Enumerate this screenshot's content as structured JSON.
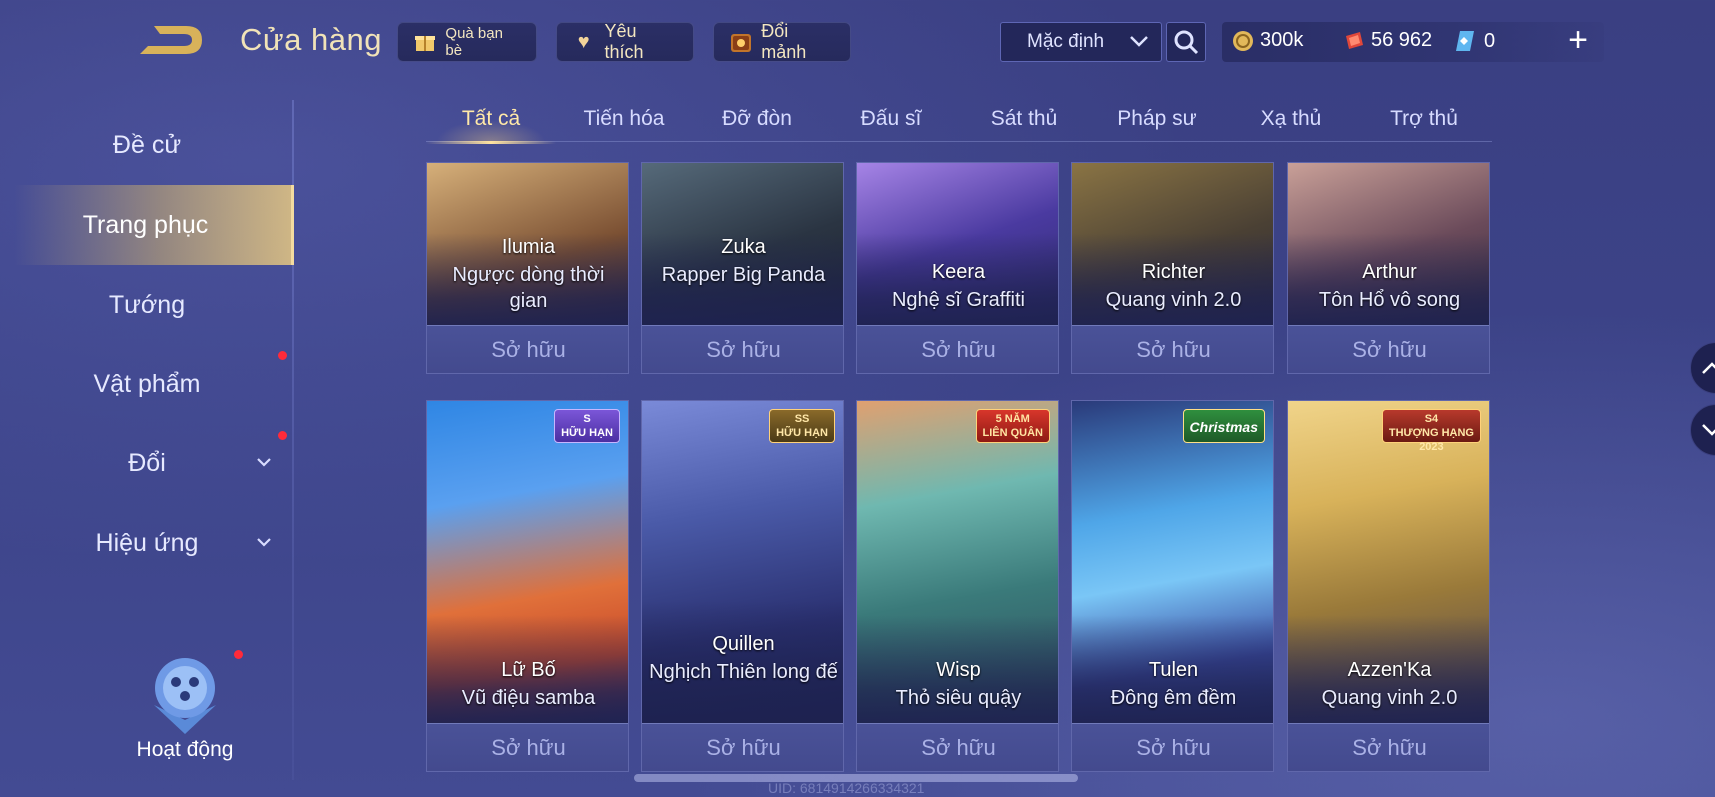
{
  "header": {
    "title": "Cửa hàng",
    "gift_label": "Quà bạn bè",
    "favorites_label": "Yêu thích",
    "shard_label": "Đổi mảnh",
    "sort_selected": "Mặc định"
  },
  "currencies": {
    "gold": "300k",
    "vouchers": "56 962",
    "diamonds": "0"
  },
  "sidebar": {
    "items": [
      {
        "label": "Đề cử"
      },
      {
        "label": "Trang phục"
      },
      {
        "label": "Tướng"
      },
      {
        "label": "Vật phẩm"
      },
      {
        "label": "Đổi"
      },
      {
        "label": "Hiệu ứng"
      }
    ],
    "activity_label": "Hoạt động"
  },
  "tabs": [
    "Tất cả",
    "Tiến hóa",
    "Đỡ đòn",
    "Đấu sĩ",
    "Sát thủ",
    "Pháp sư",
    "Xạ thủ",
    "Trợ thủ"
  ],
  "owned_label": "Sở hữu",
  "row1": [
    {
      "hero": "Ilumia",
      "skin": "Ngược dòng thời gian",
      "color_a": "#c9a46a",
      "color_b": "#5b3b2a"
    },
    {
      "hero": "Zuka",
      "skin": "Rapper Big Panda",
      "color_a": "#3c4b5e",
      "color_b": "#1d2330"
    },
    {
      "hero": "Keera",
      "skin": "Nghệ sĩ Graffiti",
      "color_a": "#8d6ad0",
      "color_b": "#2e2a6a"
    },
    {
      "hero": "Richter",
      "skin": "Quang vinh 2.0",
      "color_a": "#6c5a3a",
      "color_b": "#2d2a3a"
    },
    {
      "hero": "Arthur",
      "skin": "Tôn Hổ vô song",
      "color_a": "#b98d84",
      "color_b": "#3a2e3e"
    }
  ],
  "row2": [
    {
      "hero": "Lữ Bố",
      "skin": "Vũ điệu samba",
      "badge": "S\nHỮU HẠN",
      "color_a": "#2a78d8",
      "color_b": "#c94a2a"
    },
    {
      "hero": "Quillen",
      "skin": "Nghịch Thiên long đế",
      "badge": "SS\nHỮU HẠN",
      "color_a": "#4a5aa8",
      "color_b": "#1c2252"
    },
    {
      "hero": "Wisp",
      "skin": "Thỏ siêu quậy",
      "badge": "5 NĂM\nLIÊN QUÂN",
      "color_a": "#6fb8b0",
      "color_b": "#2f4a5a"
    },
    {
      "hero": "Tulen",
      "skin": "Đông êm đềm",
      "badge": "Christmas",
      "color_a": "#4fa6e8",
      "color_b": "#2a3a7a"
    },
    {
      "hero": "Azzen'Ka",
      "skin": "Quang vinh 2.0",
      "badge": "S4\nTHƯỢNG HẠNG\n2023",
      "color_a": "#d8b25a",
      "color_b": "#6a5a3a"
    }
  ],
  "uid_text": "UID: 6814914266334321",
  "colors": {
    "accent_gold": "#f3dba0",
    "notification_red": "#ff2a3a",
    "panel_dark": "#23275a"
  }
}
